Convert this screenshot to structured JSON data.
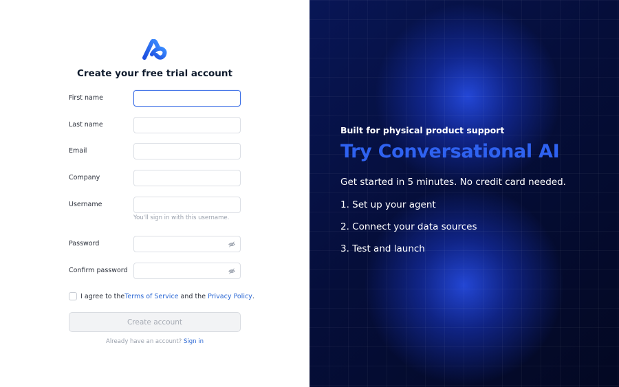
{
  "colors": {
    "accent": "#2f62f0",
    "link": "#2a67d4",
    "panel_bg": "#050e3a",
    "focus_border": "#3b6ee6"
  },
  "logo": {
    "icon": "brand-logo-icon"
  },
  "form": {
    "title": "Create your free trial account",
    "first_name": {
      "label": "First name",
      "value": ""
    },
    "last_name": {
      "label": "Last name",
      "value": ""
    },
    "email": {
      "label": "Email",
      "value": ""
    },
    "company": {
      "label": "Company",
      "value": ""
    },
    "username": {
      "label": "Username",
      "value": "",
      "hint": "You'll sign in with this username."
    },
    "password": {
      "label": "Password",
      "value": "",
      "icon": "eye-slash-icon"
    },
    "confirm_password": {
      "label": "Confirm password",
      "value": "",
      "icon": "eye-slash-icon"
    },
    "agree": {
      "prefix": "I agree to the ",
      "terms": "Terms of Service",
      "middle": " and the ",
      "privacy": "Privacy Policy",
      "suffix": "."
    },
    "create_button": "Create account",
    "signin_prompt": "Already have an account? ",
    "signin_link": "Sign in"
  },
  "promo": {
    "eyebrow": "Built for physical product support",
    "headline": "Try Conversational AI",
    "subtext": "Get started in 5 minutes. No credit card needed.",
    "steps": [
      "1. Set up your agent",
      "2. Connect your data sources",
      "3. Test and launch"
    ]
  }
}
